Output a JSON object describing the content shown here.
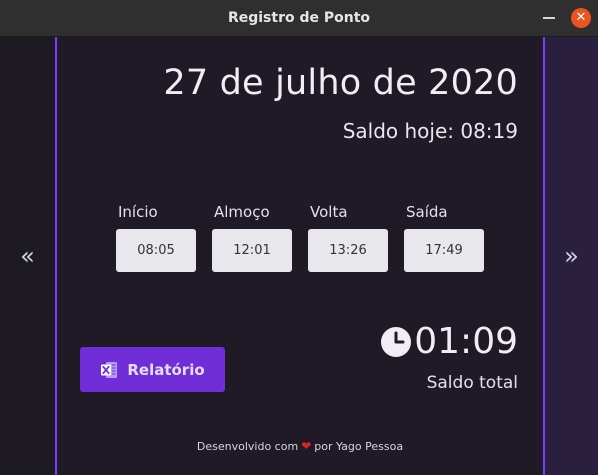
{
  "window": {
    "title": "Registro de Ponto"
  },
  "nav": {
    "prev": "«",
    "next": "»"
  },
  "header": {
    "date": "27 de julho de 2020",
    "saldo_hoje": "Saldo hoje: 08:19"
  },
  "slots": [
    {
      "label": "Início",
      "value": "08:05"
    },
    {
      "label": "Almoço",
      "value": "12:01"
    },
    {
      "label": "Volta",
      "value": "13:26"
    },
    {
      "label": "Saída",
      "value": "17:49"
    }
  ],
  "report_button": {
    "label": "Relatório",
    "icon": "excel-icon"
  },
  "saldo_total": {
    "value": "01:09",
    "label": "Saldo total",
    "icon": "clock-icon"
  },
  "footer": {
    "prefix": "Desenvolvido com",
    "suffix": "por Yago Pessoa",
    "icon": "heart-icon"
  },
  "colors": {
    "accent": "#7d3cff",
    "button": "#6f2ed8",
    "heart": "#e0202a",
    "close": "#e95420"
  }
}
